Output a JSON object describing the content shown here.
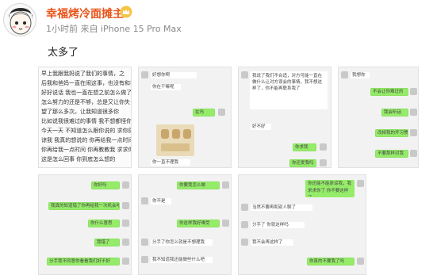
{
  "post": {
    "username": "幸福烤冷面摊主",
    "meta": "1小时前  来自 iPhone 15 Pro Max",
    "text": "太多了"
  },
  "colors": {
    "username": "#e8551c",
    "chat_background": "#f2f2f2",
    "sent_bubble": "#95ec69",
    "received_bubble": "#ffffff"
  },
  "screenshot1": {
    "lines": [
      "早上我跟我妈说了我们的事情，之",
      "后我和爸妈一直在闹这事，也没有和我",
      "好好说话  我也一直在想之前怎么做了",
      "怎么努力的还是不够，总是又让你失",
      "望了那么多次。让我知道很多你",
      "比如说我很难过的事情 我不想都怪你",
      "今天一天  不知道怎么跟你说的 求你原",
      "谅我 我真的想说的 你再给我一点时间",
      "你再给我一点时间 你再教教我 求求你",
      "这是怎么回事 你到底怎么想的"
    ]
  },
  "screenshot2": {
    "top_bubbles": [
      "好想你啊",
      "你在干嘛呢"
    ],
    "sent": "在吗",
    "bottom": "你一直不理我"
  },
  "screenshot3": {
    "received_1": "我说了我们不合适，对方可能一直在做什么让对方误会的事情，我不想这样了，你不能再联系我了",
    "received_2": "好不好",
    "sent_1": "你求我",
    "sent_2": "你还爱我吗"
  },
  "screenshot4": {
    "top": "我想你",
    "items": [
      "不会让你难过的",
      "我会听话",
      "改掉我的坏习惯",
      "不要那样对我"
    ]
  },
  "screenshot5": {
    "bubbles": [
      "你好吗",
      "我真的知道错了你再给我一次机会吧",
      "你什么意思",
      "我错了",
      "分手我不同意你看看我们好不好"
    ]
  },
  "screenshot6": {
    "bubbles": [
      "你要我怎么做",
      "你不是",
      "你这样我好难受",
      "分手了你怎么就是不想理我",
      "我不知道我还能做些什么吧"
    ]
  },
  "screenshot7": {
    "bubbles": [
      "你还能不能原谅我，我求求你了 你不要这样了",
      "当然不要再和别人聊了",
      "分手了 你就这样吗",
      "我不会再这样了",
      "你真的不要我了吗"
    ]
  }
}
